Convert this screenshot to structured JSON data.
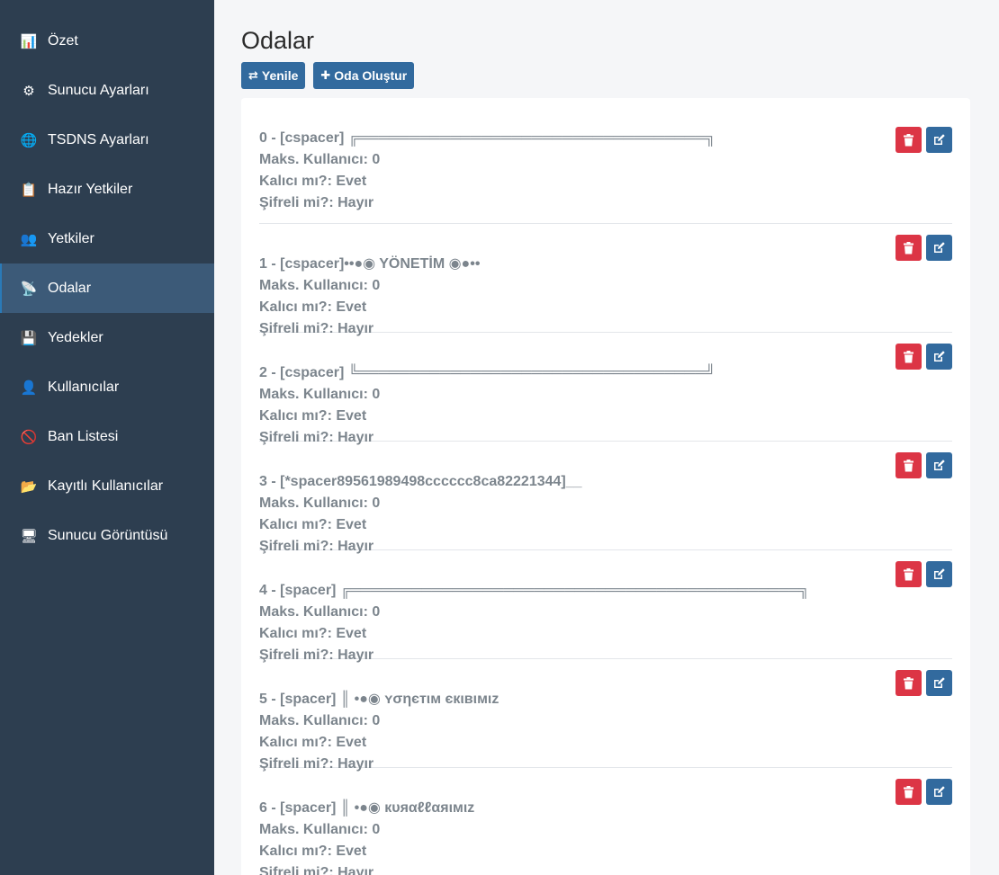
{
  "sidebar": {
    "items": [
      {
        "label": "Özet",
        "icon": "chart-icon",
        "glyph": "📊"
      },
      {
        "label": "Sunucu Ayarları",
        "icon": "gear-icon",
        "glyph": "⚙"
      },
      {
        "label": "TSDNS Ayarları",
        "icon": "globe-icon",
        "glyph": "🌐"
      },
      {
        "label": "Hazır Yetkiler",
        "icon": "clipboard-icon",
        "glyph": "📋"
      },
      {
        "label": "Yetkiler",
        "icon": "users-icon",
        "glyph": "👥"
      },
      {
        "label": "Odalar",
        "icon": "satellite-icon",
        "glyph": "📡",
        "active": true
      },
      {
        "label": "Yedekler",
        "icon": "floppy-disk-icon",
        "glyph": "💾"
      },
      {
        "label": "Kullanıcılar",
        "icon": "user-icon",
        "glyph": "👤"
      },
      {
        "label": "Ban Listesi",
        "icon": "no-entry-icon",
        "glyph": "🚫"
      },
      {
        "label": "Kayıtlı Kullanıcılar",
        "icon": "folder-icon",
        "glyph": "📂"
      },
      {
        "label": "Sunucu Görüntüsü",
        "icon": "monitor-icon",
        "glyph": "🖥"
      }
    ]
  },
  "main": {
    "title": "Odalar",
    "refresh_label": "Yenile",
    "create_label": "Oda Oluştur",
    "colors": {
      "primary": "#326a9e",
      "danger": "#dc3545",
      "sidebar": "#2d3e50"
    }
  },
  "rooms": [
    {
      "name": "0 - [cspacer] ╔══════════════════════════════════╗",
      "max_users": "Maks. Kullanıcı: 0",
      "permanent": "Kalıcı mı?: Evet",
      "encrypted": "Şifreli mi?: Hayır"
    },
    {
      "name": "1 - [cspacer]••●◉ YÖNETİM ◉●••",
      "max_users": "Maks. Kullanıcı: 0",
      "permanent": "Kalıcı mı?: Evet",
      "encrypted": "Şifreli mi?: Hayır"
    },
    {
      "name": "2 - [cspacer] ╚══════════════════════════════════╝",
      "max_users": "Maks. Kullanıcı: 0",
      "permanent": "Kalıcı mı?: Evet",
      "encrypted": "Şifreli mi?: Hayır"
    },
    {
      "name": "3 - [*spacer89561989498cccccc8ca82221344]__",
      "max_users": "Maks. Kullanıcı: 0",
      "permanent": "Kalıcı mı?: Evet",
      "encrypted": "Şifreli mi?: Hayır"
    },
    {
      "name": "4 - [spacer] ╔════════════════════════════════════════════╗",
      "max_users": "Maks. Kullanıcı: 0",
      "permanent": "Kalıcı mı?: Evet",
      "encrypted": "Şifreli mi?: Hayır"
    },
    {
      "name": "5 - [spacer] ║ •●◉ ʏσηєтιм єкιвιмιz",
      "max_users": "Maks. Kullanıcı: 0",
      "permanent": "Kalıcı mı?: Evet",
      "encrypted": "Şifreli mi?: Hayır"
    },
    {
      "name": "6 - [spacer] ║ •●◉ кυяαℓℓαяιмιz",
      "max_users": "Maks. Kullanıcı: 0",
      "permanent": "Kalıcı mı?: Evet",
      "encrypted": "Şifreli mi?: Hayır"
    }
  ]
}
